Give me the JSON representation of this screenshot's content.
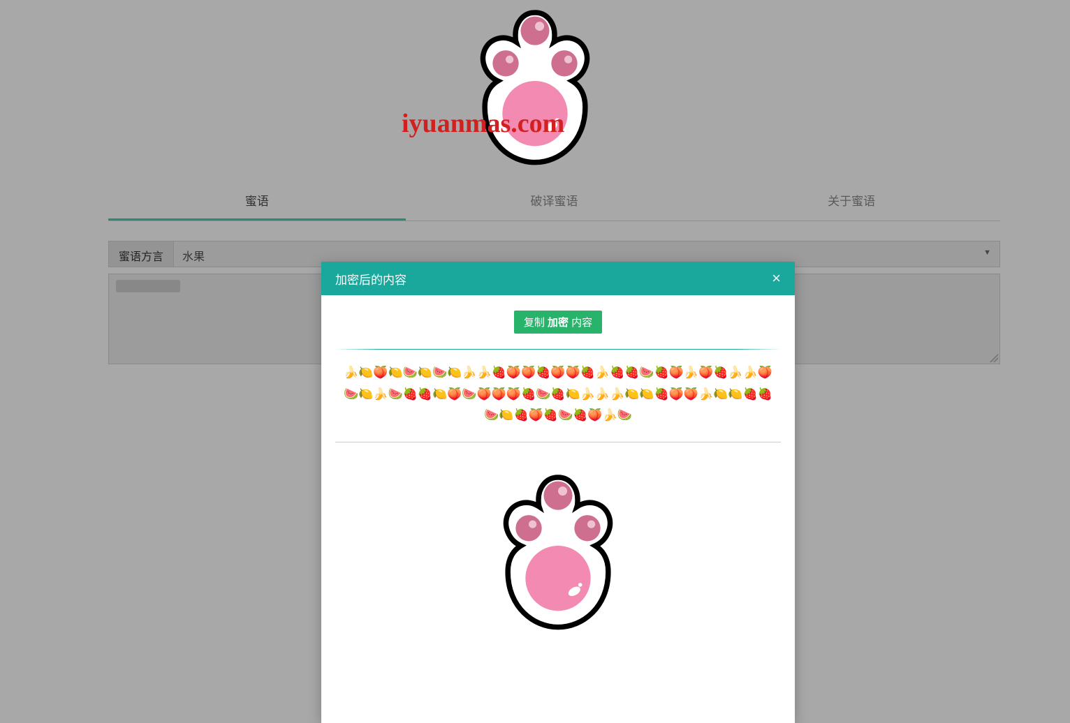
{
  "watermark": "iyuanmas.com",
  "tabs": {
    "t1": "蜜语",
    "t2": "破译蜜语",
    "t3": "关于蜜语"
  },
  "form": {
    "dialect_label": "蜜语方言",
    "dialect_selected": "水果"
  },
  "modal": {
    "title": "加密后的内容",
    "copy_prefix": "复制 ",
    "copy_bold": "加密",
    "copy_suffix": " 内容",
    "output": "🍌🍋🍑🍋🍉🍋🍉🍋🍌🍌🍓🍑🍑🍓🍑🍑🍓🍌🍓🍓🍉🍓🍑🍌🍑🍓🍌🍌🍑🍉🍋🍌🍉🍓🍓🍋🍑🍉🍑🍑🍑🍓🍉🍓🍋🍌🍌🍌🍋🍋🍓🍑🍑🍌🍋🍋🍓🍓🍉🍋🍓🍑🍓🍉🍓🍑🍌🍉"
  }
}
